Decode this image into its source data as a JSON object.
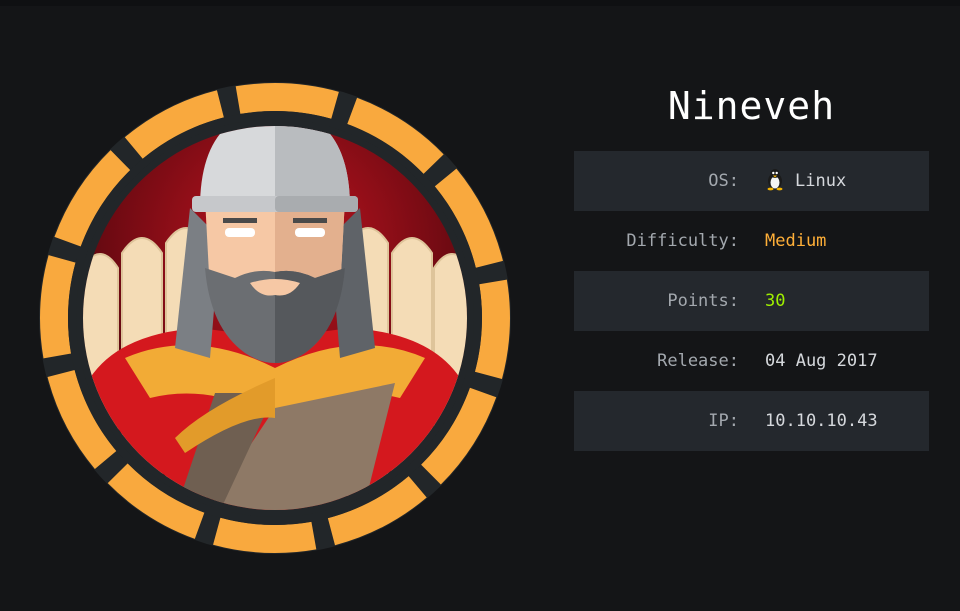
{
  "machine": {
    "name": "Nineveh"
  },
  "info": {
    "os_label": "OS:",
    "os_value": "Linux",
    "os_icon": "linux-penguin-icon",
    "difficulty_label": "Difficulty:",
    "difficulty_value": "Medium",
    "points_label": "Points:",
    "points_value": "30",
    "release_label": "Release:",
    "release_value": "04 Aug 2017",
    "ip_label": "IP:",
    "ip_value": "10.10.10.43"
  },
  "colors": {
    "background": "#141517",
    "row_shade": "#24282d",
    "label": "#a3a8ae",
    "value": "#d5d8dc",
    "difficulty_medium": "#ffaf38",
    "points": "#9fef00",
    "avatar_ring": "#f9a93e",
    "avatar_ring_dark": "#222629"
  }
}
